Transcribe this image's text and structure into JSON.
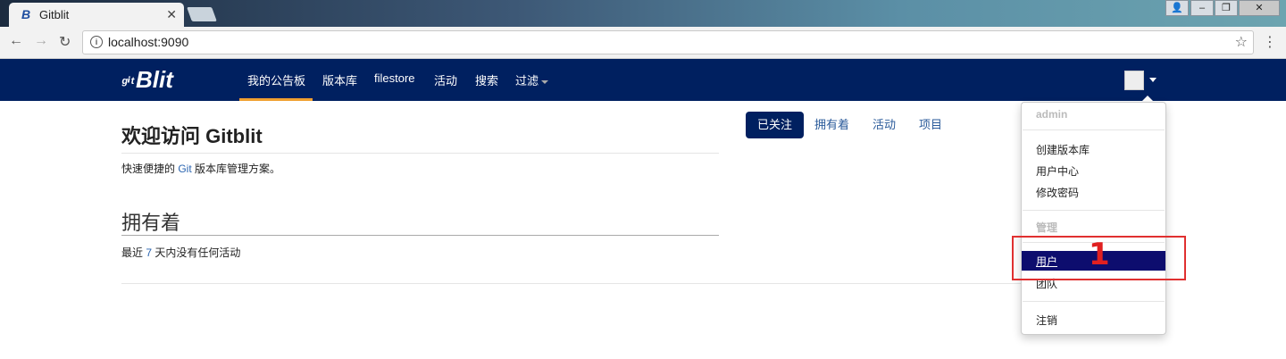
{
  "browser": {
    "tab_title": "Gitblit",
    "tab_favicon": "B",
    "tab_close": "✕",
    "url": "localhost:9090",
    "back": "←",
    "forward": "→",
    "reload": "↻",
    "star": "☆",
    "menu": "⋮",
    "win_user": "👤",
    "win_min": "–",
    "win_max": "❐",
    "win_close": "✕"
  },
  "navbar": {
    "brand_prefix": "ᵍⁱᵗ",
    "brand": "Blit",
    "items": [
      {
        "label": "我的公告板"
      },
      {
        "label": "版本库"
      },
      {
        "label": "filestore"
      },
      {
        "label": "活动"
      },
      {
        "label": "搜索"
      },
      {
        "label": "过滤"
      }
    ]
  },
  "main": {
    "welcome_title": "欢迎访问 Gitblit",
    "tagline_before": "快速便捷的 ",
    "tagline_link": "Git",
    "tagline_after": " 版本库管理方案。",
    "section_title": "拥有着",
    "activity_before": "最近 ",
    "activity_days": "7",
    "activity_after": " 天内没有任何活动"
  },
  "pills": [
    {
      "label": "已关注",
      "active": true
    },
    {
      "label": "拥有着"
    },
    {
      "label": "活动"
    },
    {
      "label": "项目"
    }
  ],
  "dropdown": {
    "user_header": "admin",
    "items_user": [
      "创建版本库",
      "用户中心",
      "修改密码"
    ],
    "admin_header": "管理",
    "item_users": "用户",
    "item_teams": "团队",
    "item_logout": "注销"
  },
  "annotation": {
    "number": "1",
    "color": "#e02020"
  },
  "colors": {
    "navbar": "#002060",
    "accent": "#f0a030",
    "link": "#2a64b0"
  }
}
